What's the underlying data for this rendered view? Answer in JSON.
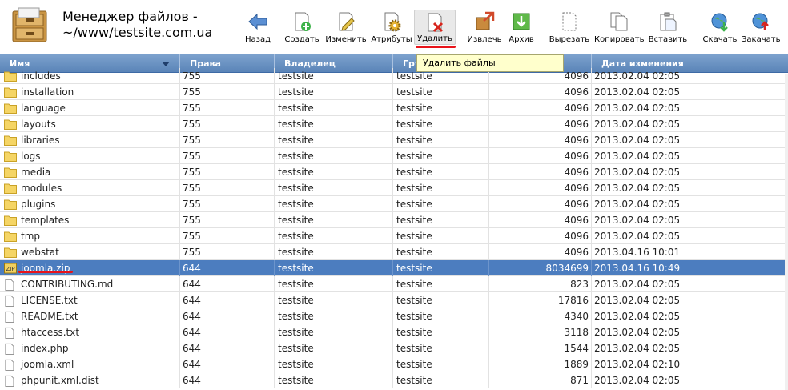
{
  "header": {
    "title_line1": "Менеджер файлов -",
    "title_line2": "~/www/testsite.com.ua"
  },
  "toolbar": {
    "buttons": [
      {
        "key": "back",
        "label": "Назад",
        "icon": "back-arrow-icon"
      },
      {
        "key": "create",
        "label": "Создать",
        "icon": "new-file-icon"
      },
      {
        "key": "edit",
        "label": "Изменить",
        "icon": "edit-file-icon"
      },
      {
        "key": "attrs",
        "label": "Атрибуты",
        "icon": "gear-icon"
      },
      {
        "key": "delete",
        "label": "Удалить",
        "icon": "delete-file-icon"
      },
      {
        "key": "extract",
        "label": "Извлечь",
        "icon": "extract-icon"
      },
      {
        "key": "archive",
        "label": "Архив",
        "icon": "archive-icon"
      },
      {
        "key": "cut",
        "label": "Вырезать",
        "icon": "cut-icon"
      },
      {
        "key": "copy",
        "label": "Копировать",
        "icon": "copy-icon"
      },
      {
        "key": "paste",
        "label": "Вставить",
        "icon": "paste-icon"
      },
      {
        "key": "download",
        "label": "Скачать",
        "icon": "download-globe-icon"
      },
      {
        "key": "upload",
        "label": "Закачать",
        "icon": "upload-globe-icon"
      }
    ],
    "tooltip": "Удалить файлы"
  },
  "table": {
    "headers": {
      "name": "Имя",
      "perm": "Права",
      "owner": "Владелец",
      "group": "Гру",
      "size": "",
      "date": "Дата изменения"
    },
    "rows": [
      {
        "type": "folder",
        "name": "includes",
        "perm": "755",
        "owner": "testsite",
        "group": "testsite",
        "size": "4096",
        "date": "2013.02.04 02:05"
      },
      {
        "type": "folder",
        "name": "installation",
        "perm": "755",
        "owner": "testsite",
        "group": "testsite",
        "size": "4096",
        "date": "2013.02.04 02:05"
      },
      {
        "type": "folder",
        "name": "language",
        "perm": "755",
        "owner": "testsite",
        "group": "testsite",
        "size": "4096",
        "date": "2013.02.04 02:05"
      },
      {
        "type": "folder",
        "name": "layouts",
        "perm": "755",
        "owner": "testsite",
        "group": "testsite",
        "size": "4096",
        "date": "2013.02.04 02:05"
      },
      {
        "type": "folder",
        "name": "libraries",
        "perm": "755",
        "owner": "testsite",
        "group": "testsite",
        "size": "4096",
        "date": "2013.02.04 02:05"
      },
      {
        "type": "folder",
        "name": "logs",
        "perm": "755",
        "owner": "testsite",
        "group": "testsite",
        "size": "4096",
        "date": "2013.02.04 02:05"
      },
      {
        "type": "folder",
        "name": "media",
        "perm": "755",
        "owner": "testsite",
        "group": "testsite",
        "size": "4096",
        "date": "2013.02.04 02:05"
      },
      {
        "type": "folder",
        "name": "modules",
        "perm": "755",
        "owner": "testsite",
        "group": "testsite",
        "size": "4096",
        "date": "2013.02.04 02:05"
      },
      {
        "type": "folder",
        "name": "plugins",
        "perm": "755",
        "owner": "testsite",
        "group": "testsite",
        "size": "4096",
        "date": "2013.02.04 02:05"
      },
      {
        "type": "folder",
        "name": "templates",
        "perm": "755",
        "owner": "testsite",
        "group": "testsite",
        "size": "4096",
        "date": "2013.02.04 02:05"
      },
      {
        "type": "folder",
        "name": "tmp",
        "perm": "755",
        "owner": "testsite",
        "group": "testsite",
        "size": "4096",
        "date": "2013.02.04 02:05"
      },
      {
        "type": "folder",
        "name": "webstat",
        "perm": "755",
        "owner": "testsite",
        "group": "testsite",
        "size": "4096",
        "date": "2013.04.16 10:01"
      },
      {
        "type": "zip",
        "name": "joomla.zip",
        "perm": "644",
        "owner": "testsite",
        "group": "testsite",
        "size": "8034699",
        "date": "2013.04.16 10:49",
        "selected": true
      },
      {
        "type": "file",
        "name": "CONTRIBUTING.md",
        "perm": "644",
        "owner": "testsite",
        "group": "testsite",
        "size": "823",
        "date": "2013.02.04 02:05"
      },
      {
        "type": "file",
        "name": "LICENSE.txt",
        "perm": "644",
        "owner": "testsite",
        "group": "testsite",
        "size": "17816",
        "date": "2013.02.04 02:05"
      },
      {
        "type": "file",
        "name": "README.txt",
        "perm": "644",
        "owner": "testsite",
        "group": "testsite",
        "size": "4340",
        "date": "2013.02.04 02:05"
      },
      {
        "type": "file",
        "name": "htaccess.txt",
        "perm": "644",
        "owner": "testsite",
        "group": "testsite",
        "size": "3118",
        "date": "2013.02.04 02:05"
      },
      {
        "type": "file",
        "name": "index.php",
        "perm": "644",
        "owner": "testsite",
        "group": "testsite",
        "size": "1544",
        "date": "2013.02.04 02:05"
      },
      {
        "type": "file",
        "name": "joomla.xml",
        "perm": "644",
        "owner": "testsite",
        "group": "testsite",
        "size": "1889",
        "date": "2013.02.04 02:10"
      },
      {
        "type": "file",
        "name": "phpunit.xml.dist",
        "perm": "644",
        "owner": "testsite",
        "group": "testsite",
        "size": "871",
        "date": "2013.02.04 02:05"
      }
    ]
  },
  "colors": {
    "header_bg": "#6a93c6",
    "selected_row": "#4c7dbf",
    "highlight_red": "#e8131a",
    "tooltip_bg": "#ffffcc"
  }
}
